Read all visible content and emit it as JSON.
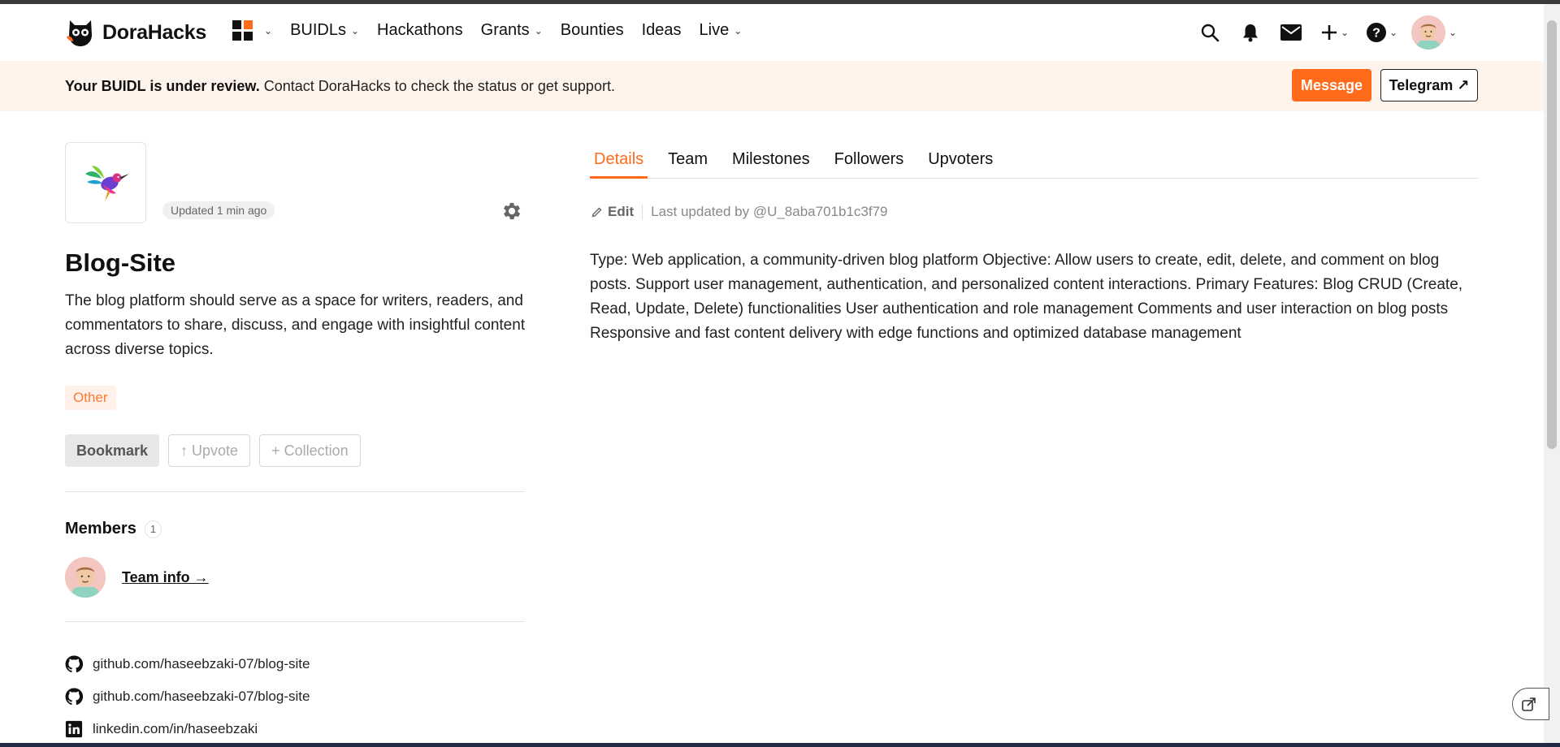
{
  "brand": {
    "name": "DoraHacks",
    "accent": "#ff6b1a"
  },
  "nav": {
    "items": [
      {
        "label": "BUIDLs",
        "has_menu": true
      },
      {
        "label": "Hackathons",
        "has_menu": false
      },
      {
        "label": "Grants",
        "has_menu": true
      },
      {
        "label": "Bounties",
        "has_menu": false
      },
      {
        "label": "Ideas",
        "has_menu": false
      },
      {
        "label": "Live",
        "has_menu": true
      }
    ],
    "icons": [
      "apps-icon",
      "search-icon",
      "bell-icon",
      "mail-icon",
      "plus-icon",
      "help-icon",
      "avatar"
    ]
  },
  "banner": {
    "bold": "Your BUIDL is under review.",
    "text": " Contact DoraHacks to check the status or get support.",
    "message_label": "Message",
    "telegram_label": "Telegram ↗"
  },
  "project": {
    "updated": "Updated 1 min ago",
    "title": "Blog-Site",
    "description": "The blog platform should serve as a space for writers, readers, and commentators to share, discuss, and engage with insightful content across diverse topics.",
    "tag": "Other",
    "actions": {
      "bookmark": "Bookmark",
      "upvote": "↑ Upvote",
      "collection": "+ Collection"
    }
  },
  "members": {
    "title": "Members",
    "count": "1",
    "team_link": "Team info →"
  },
  "links": [
    {
      "icon": "github-icon",
      "text": "github.com/haseebzaki-07/blog-site"
    },
    {
      "icon": "github-icon",
      "text": "github.com/haseebzaki-07/blog-site"
    },
    {
      "icon": "linkedin-icon",
      "text": "linkedin.com/in/haseebzaki"
    }
  ],
  "tabs": [
    "Details",
    "Team",
    "Milestones",
    "Followers",
    "Upvoters"
  ],
  "details": {
    "edit_label": "Edit",
    "last_updated": "Last updated by @U_8aba701b1c3f79",
    "body": "Type: Web application, a community-driven blog platform Objective: Allow users to create, edit, delete, and comment on blog posts. Support user management, authentication, and personalized content interactions. Primary Features: Blog CRUD (Create, Read, Update, Delete) functionalities User authentication and role management Comments and user interaction on blog posts Responsive and fast content delivery with edge functions and optimized database management"
  }
}
